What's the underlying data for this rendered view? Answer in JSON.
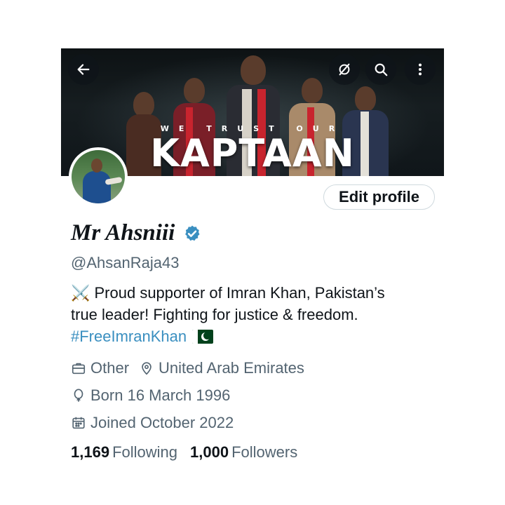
{
  "banner": {
    "subtitle": "WE TRUST OUR",
    "title": "KAPTAAN"
  },
  "top_buttons": {
    "back_icon": "arrow-left-icon",
    "rotate_icon": "refresh-icon",
    "search_icon": "search-icon",
    "more_icon": "more-vertical-icon"
  },
  "profile": {
    "edit_label": "Edit profile",
    "display_name": "Mr Ahsniii",
    "verified": true,
    "handle": "@AhsanRaja43",
    "bio_line1": "⚔️ Proud supporter of Imran Khan, Pakistan’s",
    "bio_line2": "true leader! Fighting for justice & freedom.",
    "hashtag": "#FreeImranKhan",
    "category": "Other",
    "location": "United Arab Emirates",
    "born": "Born 16 March 1996",
    "joined": "Joined October 2022",
    "following_count": "1,169",
    "following_label": "Following",
    "followers_count": "1,000",
    "followers_label": "Followers"
  },
  "colors": {
    "verified_badge": "#3a8fc0",
    "hashtag": "#3a8fc0",
    "secondary_text": "#536471"
  }
}
